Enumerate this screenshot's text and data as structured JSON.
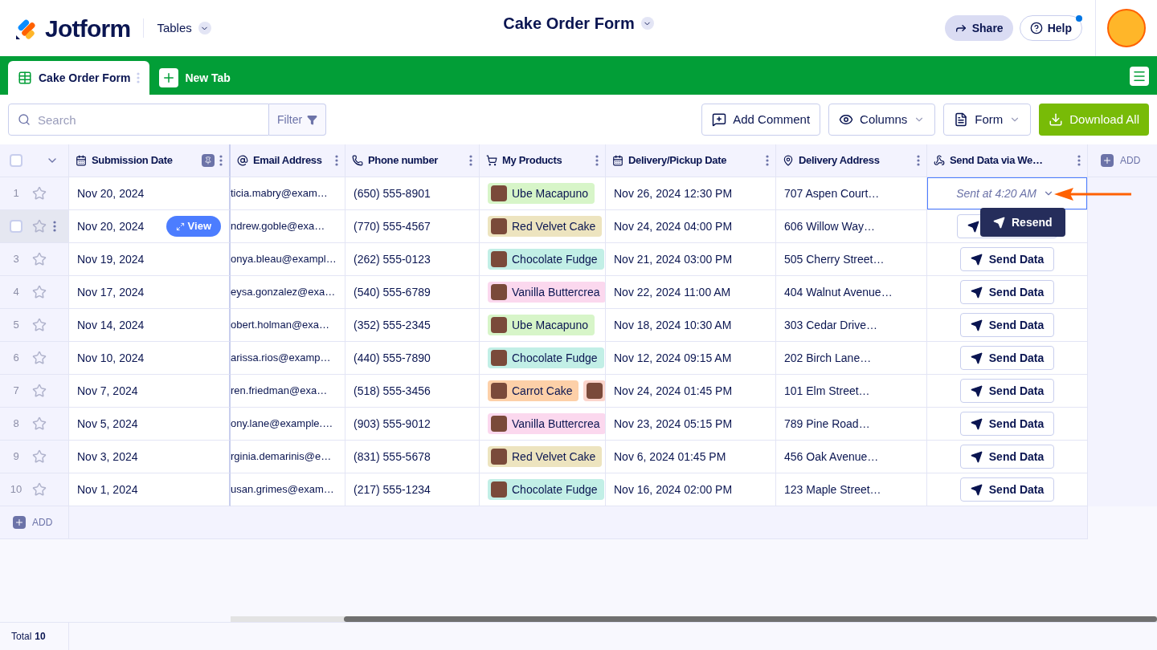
{
  "header": {
    "logo": "Jotform",
    "section": "Tables",
    "title": "Cake Order Form",
    "share": "Share",
    "help": "Help",
    "help_notification": true
  },
  "tabs": [
    {
      "label": "Cake Order Form",
      "selected": true
    }
  ],
  "new_tab": "New Tab",
  "toolbar": {
    "search": {
      "placeholder": "Search"
    },
    "filter": "Filter",
    "buttons": [
      {
        "kind": "comment",
        "label": "Add Comment"
      },
      {
        "kind": "columns",
        "label": "Columns"
      },
      {
        "kind": "form",
        "label": "Form"
      },
      {
        "kind": "download",
        "label": "Download All"
      }
    ]
  },
  "columns": [
    {
      "kind": "date",
      "label": "Submission Date",
      "pinned": true
    },
    {
      "kind": "email",
      "label": "Email Address",
      "pinned": false
    },
    {
      "kind": "phone",
      "label": "Phone number",
      "pinned": false
    },
    {
      "kind": "cart",
      "label": "My Products",
      "pinned": false
    },
    {
      "kind": "date",
      "label": "Delivery/Pickup Date",
      "pinned": false
    },
    {
      "kind": "location",
      "label": "Delivery Address",
      "pinned": false
    },
    {
      "kind": "webhook",
      "label": "Send Data via We…",
      "pinned": false
    }
  ],
  "select_all": {
    "checked": false
  },
  "add_column": "ADD",
  "rows": [
    {
      "number": "1",
      "starred": false,
      "date": "Nov 20, 2024",
      "email": "ticia.mabry@exam…",
      "phone": "(650) 555-8901",
      "products": [
        {
          "label": "Ube Macapuno",
          "color": "#d7f5c8"
        }
      ],
      "delivery": "Nov 26, 2024 12:30 PM",
      "address": "707 Aspen Court…",
      "send": {
        "kind": "sent",
        "label": "Sent at 4:20 AM",
        "selected": true,
        "popover": "Resend"
      }
    },
    {
      "checked": false,
      "starred": false,
      "view": "View",
      "date": "Nov 20, 2024",
      "email": "ndrew.goble@exa…",
      "phone": "(770) 555-4567",
      "products": [
        {
          "label": "Red Velvet Cake",
          "color": "#ede4bf"
        }
      ],
      "delivery": "Nov 24, 2024 04:00 PM",
      "address": "606 Willow Way…",
      "send": {
        "kind": "button",
        "selected": false
      }
    },
    {
      "number": "3",
      "starred": false,
      "date": "Nov 19, 2024",
      "email": "onya.bleau@exampl…",
      "phone": "(262) 555-0123",
      "products": [
        {
          "label": "Chocolate Fudge",
          "color": "#c2efe6"
        }
      ],
      "delivery": "Nov 21, 2024 03:00 PM",
      "address": "505 Cherry Street…",
      "send": {
        "kind": "button",
        "label": "Send Data",
        "selected": false
      }
    },
    {
      "number": "4",
      "starred": false,
      "date": "Nov 17, 2024",
      "email": "eysa.gonzalez@exa…",
      "phone": "(540) 555-6789",
      "products": [
        {
          "label": "Vanilla Buttercrea",
          "color": "#fbd8ee"
        }
      ],
      "delivery": "Nov 22, 2024 11:00 AM",
      "address": "404 Walnut Avenue…",
      "send": {
        "kind": "button",
        "label": "Send Data",
        "selected": false
      }
    },
    {
      "number": "5",
      "starred": false,
      "date": "Nov 14, 2024",
      "email": "obert.holman@exa…",
      "phone": "(352) 555-2345",
      "products": [
        {
          "label": "Ube Macapuno",
          "color": "#d7f5c8"
        }
      ],
      "delivery": "Nov 18, 2024 10:30 AM",
      "address": "303 Cedar Drive…",
      "send": {
        "kind": "button",
        "label": "Send Data",
        "selected": false
      }
    },
    {
      "number": "6",
      "starred": false,
      "date": "Nov 10, 2024",
      "email": "arissa.rios@examp…",
      "phone": "(440) 555-7890",
      "products": [
        {
          "label": "Chocolate Fudge",
          "color": "#c2efe6"
        }
      ],
      "delivery": "Nov 12, 2024 09:15 AM",
      "address": "202 Birch Lane…",
      "send": {
        "kind": "button",
        "label": "Send Data",
        "selected": false
      }
    },
    {
      "number": "7",
      "starred": false,
      "date": "Nov 7, 2024",
      "email": "ren.friedman@exa…",
      "phone": "(518) 555-3456",
      "products": [
        {
          "label": "Carrot Cake",
          "color": "#fdd0a8"
        },
        {
          "color": "#fbd5cc"
        }
      ],
      "delivery": "Nov 24, 2024 01:45 PM",
      "address": "101 Elm Street…",
      "send": {
        "kind": "button",
        "label": "Send Data",
        "selected": false
      }
    },
    {
      "number": "8",
      "starred": false,
      "date": "Nov 5, 2024",
      "email": "ony.lane@example.…",
      "phone": "(903) 555-9012",
      "products": [
        {
          "label": "Vanilla Buttercrea",
          "color": "#fbd8ee"
        }
      ],
      "delivery": "Nov 23, 2024 05:15 PM",
      "address": "789 Pine Road…",
      "send": {
        "kind": "button",
        "label": "Send Data",
        "selected": false
      }
    },
    {
      "number": "9",
      "starred": false,
      "date": "Nov 3, 2024",
      "email": "rginia.demarinis@e…",
      "phone": "(831) 555-5678",
      "products": [
        {
          "label": "Red Velvet Cake",
          "color": "#ede4bf"
        }
      ],
      "delivery": "Nov 6, 2024 01:45 PM",
      "address": "456 Oak Avenue…",
      "send": {
        "kind": "button",
        "label": "Send Data",
        "selected": false
      }
    },
    {
      "number": "10",
      "starred": false,
      "date": "Nov 1, 2024",
      "email": "usan.grimes@exam…",
      "phone": "(217) 555-1234",
      "products": [
        {
          "label": "Chocolate Fudge",
          "color": "#c2efe6"
        }
      ],
      "delivery": "Nov 16, 2024 02:00 PM",
      "address": "123 Maple Street…",
      "send": {
        "kind": "button",
        "label": "Send Data",
        "selected": false
      }
    }
  ],
  "add_row": "ADD",
  "footer": {
    "label": "Total",
    "count": "10"
  }
}
